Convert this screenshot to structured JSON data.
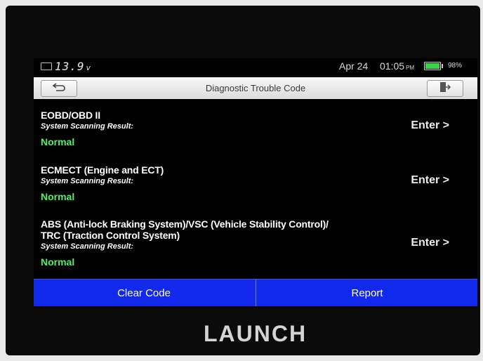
{
  "status_bar": {
    "voltage": "13.9",
    "voltage_unit": "v",
    "date": "Apr 24",
    "time": "01:05",
    "ampm": "PM",
    "battery_percent_label": "98%",
    "battery_level": 0.98
  },
  "title_bar": {
    "title": "Diagnostic Trouble Code",
    "back_icon": "back-arrow-icon",
    "exit_icon": "exit-door-icon"
  },
  "systems": [
    {
      "name_lines": [
        "EOBD/OBD II"
      ],
      "scan_label": "System Scanning Result:",
      "result": "Normal",
      "enter_label": "Enter >"
    },
    {
      "name_lines": [
        "ECMECT (Engine and ECT)"
      ],
      "scan_label": "System Scanning Result:",
      "result": "Normal",
      "enter_label": "Enter >"
    },
    {
      "name_lines": [
        "ABS (Anti-lock Braking System)/VSC (Vehicle Stability Control)/",
        "TRC (Traction Control System)"
      ],
      "scan_label": "System Scanning Result:",
      "result": "Normal",
      "enter_label": "Enter >"
    }
  ],
  "actions": {
    "clear_code": "Clear Code",
    "report": "Report"
  },
  "brand": "LAUNCH",
  "colors": {
    "result_ok": "#4cf26a",
    "button_bar": "#1228ea",
    "battery": "#3ad34b"
  }
}
